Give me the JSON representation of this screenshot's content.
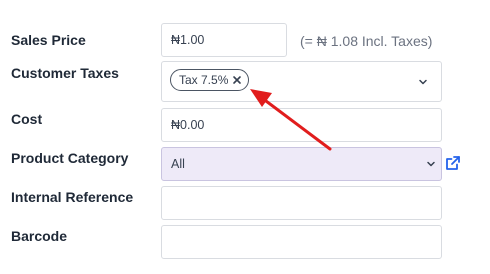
{
  "rows": {
    "sales_price": {
      "label": "Sales Price",
      "value": "₦1.00",
      "incl_note": "(= ₦ 1.08 Incl. Taxes)"
    },
    "customer_taxes": {
      "label": "Customer Taxes",
      "tag": "Tax 7.5%"
    },
    "cost": {
      "label": "Cost",
      "value": "₦0.00"
    },
    "product_category": {
      "label": "Product Category",
      "value": "All"
    },
    "internal_reference": {
      "label": "Internal Reference",
      "value": ""
    },
    "barcode": {
      "label": "Barcode",
      "value": ""
    }
  },
  "icons": {
    "chevron": "chevron-down-icon",
    "remove": "close-icon",
    "external": "external-link-icon"
  },
  "colors": {
    "accent": "#2563eb",
    "annotation_arrow": "#e11d1d",
    "category_bg": "#eeeaf8"
  }
}
